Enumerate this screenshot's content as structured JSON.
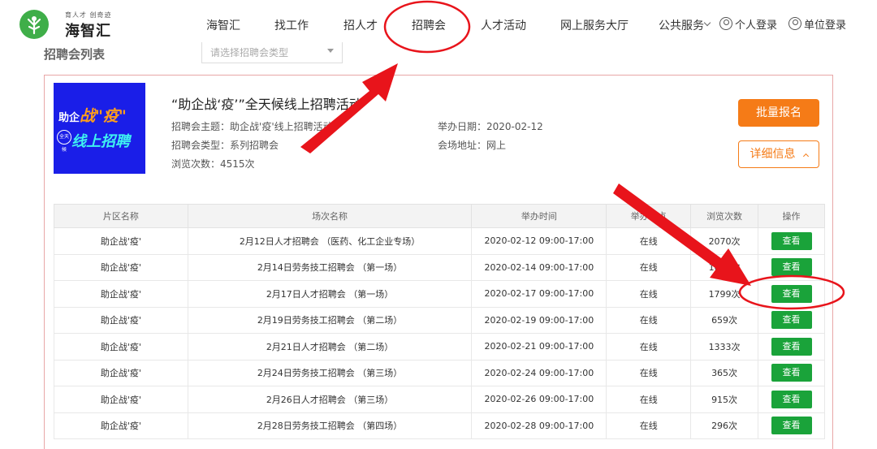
{
  "header": {
    "slogan": "育人才 创奇迹",
    "brand": "海智汇",
    "nav": [
      "海智汇",
      "找工作",
      "招人才",
      "招聘会",
      "人才活动",
      "网上服务大厅",
      "公共服务"
    ],
    "personal_login": "个人登录",
    "company_login": "单位登录"
  },
  "list": {
    "title": "招聘会列表",
    "type_placeholder": "请选择招聘会类型"
  },
  "fair": {
    "poster": {
      "line1": "助企",
      "line1_em": "战\"疫\"",
      "badge": "全天候",
      "line2": "线上招聘"
    },
    "title": "“助企战‘疫’”全天候线上招聘活动",
    "theme_label": "招聘会主题：",
    "theme": "助企战'疫'线上招聘活动",
    "type_label": "招聘会类型：",
    "type": "系列招聘会",
    "views_label": "浏览次数：",
    "views": "4515次",
    "date_label": "举办日期：",
    "date": "2020-02-12",
    "venue_label": "会场地址：",
    "venue": "网上",
    "batch_btn": "批量报名",
    "detail_btn": "详细信息"
  },
  "table": {
    "headers": [
      "片区名称",
      "场次名称",
      "举办时间",
      "举办地点",
      "浏览次数",
      "操作"
    ],
    "rows": [
      [
        "助企战'疫'",
        "2月12日人才招聘会 （医药、化工企业专场）",
        "2020-02-12 09:00-17:00",
        "在线",
        "2070次",
        "查看"
      ],
      [
        "助企战'疫'",
        "2月14日劳务技工招聘会 （第一场）",
        "2020-02-14 09:00-17:00",
        "在线",
        "1058次",
        "查看"
      ],
      [
        "助企战'疫'",
        "2月17日人才招聘会 （第一场）",
        "2020-02-17 09:00-17:00",
        "在线",
        "1799次",
        "查看"
      ],
      [
        "助企战'疫'",
        "2月19日劳务技工招聘会 （第二场）",
        "2020-02-19 09:00-17:00",
        "在线",
        "659次",
        "查看"
      ],
      [
        "助企战'疫'",
        "2月21日人才招聘会 （第二场）",
        "2020-02-21 09:00-17:00",
        "在线",
        "1333次",
        "查看"
      ],
      [
        "助企战'疫'",
        "2月24日劳务技工招聘会 （第三场）",
        "2020-02-24 09:00-17:00",
        "在线",
        "365次",
        "查看"
      ],
      [
        "助企战'疫'",
        "2月26日人才招聘会 （第三场）",
        "2020-02-26 09:00-17:00",
        "在线",
        "915次",
        "查看"
      ],
      [
        "助企战'疫'",
        "2月28日劳务技工招聘会 （第四场）",
        "2020-02-28 09:00-17:00",
        "在线",
        "296次",
        "查看"
      ]
    ]
  },
  "colors": {
    "accent_orange": "#f57b17",
    "view_green": "#1aa33a",
    "logo_green": "#3fae49",
    "annotation_red": "#e8141b"
  }
}
